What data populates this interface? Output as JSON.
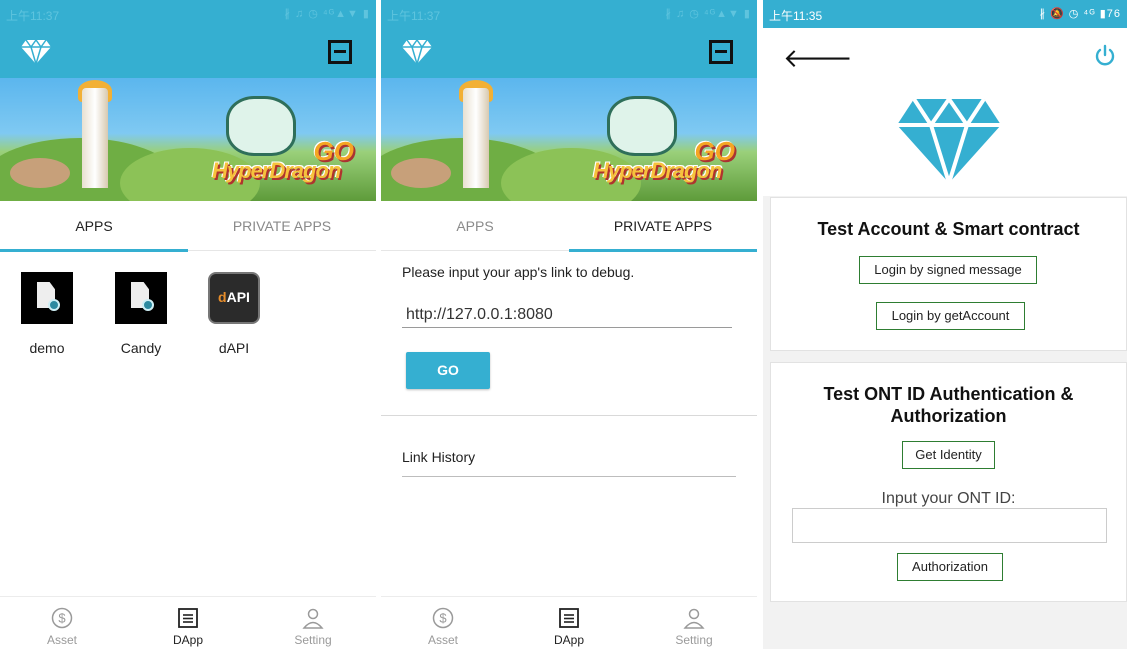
{
  "screen1": {
    "status": {
      "time": "上午11:37",
      "icons": "∦ ♫ ◷ ⁴ᴳ▲▼ ▮"
    },
    "tabs": {
      "apps": "APPS",
      "private_apps": "PRIVATE APPS"
    },
    "apps": [
      {
        "name": "demo",
        "icon": "document-icon"
      },
      {
        "name": "Candy",
        "icon": "document-icon"
      },
      {
        "name": "dAPI",
        "icon": "dapi-icon"
      }
    ],
    "nav": {
      "asset": "Asset",
      "dapp": "DApp",
      "setting": "Setting"
    }
  },
  "screen2": {
    "status": {
      "time": "上午11:37",
      "icons": "∦ ♫ ◷ ⁴ᴳ▲▼ ▮"
    },
    "tabs": {
      "apps": "APPS",
      "private_apps": "PRIVATE APPS"
    },
    "debug_label": "Please input your app's link to debug.",
    "debug_value": "http://127.0.0.1:8080",
    "go_label": "GO",
    "history_label": "Link History",
    "nav": {
      "asset": "Asset",
      "dapp": "DApp",
      "setting": "Setting"
    }
  },
  "screen3": {
    "status": {
      "time": "上午11:35",
      "icons": "∦ 🔕 ◷ ⁴ᴳ ▮76"
    },
    "card1": {
      "title": "Test Account & Smart contract",
      "btn_signed": "Login by signed message",
      "btn_get_account": "Login by getAccount"
    },
    "card2": {
      "title_line1": "Test ONT ID Authentication &",
      "title_line2": "Authorization",
      "btn_get_identity": "Get Identity",
      "ont_label": "Input your ONT ID:",
      "ont_value": "",
      "btn_authorization": "Authorization"
    }
  },
  "colors": {
    "accent": "#35afd1",
    "button_border": "#2e7d32"
  },
  "banner": {
    "text_go": "GO",
    "text_title": "HyperDragon"
  }
}
